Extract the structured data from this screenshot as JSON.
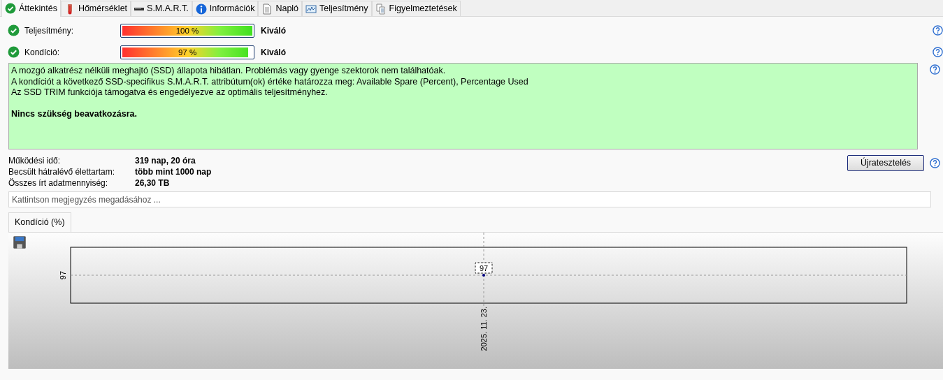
{
  "tabs": [
    {
      "label": "Áttekintés",
      "selected": true
    },
    {
      "label": "Hőmérséklet",
      "selected": false
    },
    {
      "label": "S.M.A.R.T.",
      "selected": false
    },
    {
      "label": "Információk",
      "selected": false
    },
    {
      "label": "Napló",
      "selected": false
    },
    {
      "label": "Teljesítmény",
      "selected": false
    },
    {
      "label": "Figyelmeztetések",
      "selected": false
    }
  ],
  "meters": [
    {
      "label": "Teljesítmény:",
      "level": 1.0,
      "reading": "100 %",
      "rating": "Kiváló"
    },
    {
      "label": "Kondíció:",
      "level": 0.97,
      "reading": "97 %",
      "rating": "Kiváló"
    }
  ],
  "status_box": {
    "lines": [
      "A mozgó alkatrész nélküli meghajtó (SSD) állapota hibátlan. Problémás vagy gyenge szektorok nem találhatóak.",
      "A kondíciót a következő SSD-specifikus S.M.A.R.T. attribútum(ok) értéke határozza meg:  Available Spare (Percent), Percentage Used",
      "Az SSD TRIM funkciója támogatva és engedélyezve az optimális teljesítményhez."
    ],
    "conclusion": "Nincs szükség beavatkozásra."
  },
  "stats": [
    {
      "label": "Működési idő:",
      "value": "319 nap, 20 óra"
    },
    {
      "label": "Becsült hátralévő élettartam:",
      "value": "több mint 1000 nap"
    },
    {
      "label": "Összes írt adatmennyiség:",
      "value": "26,30 TB"
    }
  ],
  "retest_button": "Újratesztelés",
  "note": {
    "placeholder": "Kattintson megjegyzés megadásához ..."
  },
  "chart_tabs": [
    {
      "label": "Kondíció  (%)",
      "selected": true
    }
  ],
  "chart": {
    "y_tick_label": "97",
    "x_label": "2025. 11. 23.",
    "point_label": "97"
  }
}
